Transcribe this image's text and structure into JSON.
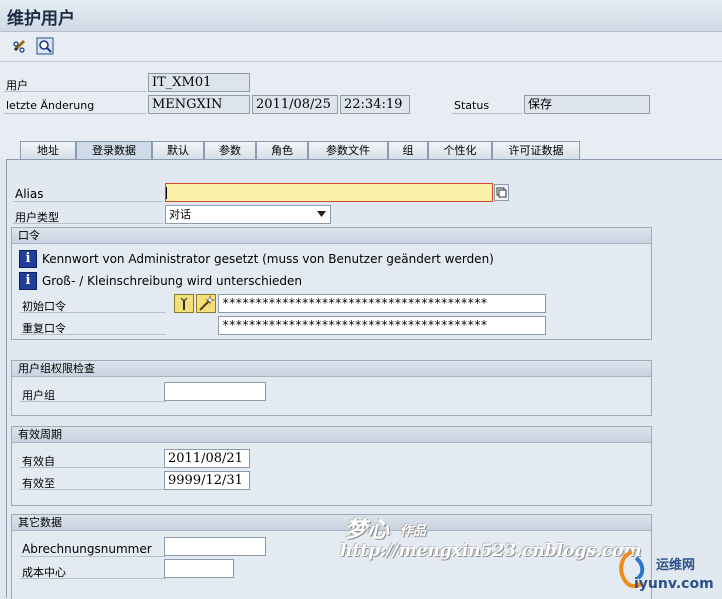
{
  "window": {
    "title": "维护用户"
  },
  "header": {
    "user_label": "用户",
    "user_value": "IT_XM01",
    "changed_label": "letzte Änderung",
    "changed_by": "MENGXIN",
    "changed_date": "2011/08/25",
    "changed_time": "22:34:19",
    "status_label": "Status",
    "status_value": "保存"
  },
  "tabs": [
    "地址",
    "登录数据",
    "默认",
    "参数",
    "角色",
    "参数文件",
    "组",
    "个性化",
    "许可证数据"
  ],
  "active_tab": "登录数据",
  "logon": {
    "alias_label": "Alias",
    "alias_value": "",
    "user_type_label": "用户类型",
    "user_type_value": "对话"
  },
  "password": {
    "section_title": "口令",
    "msg1": "Kennwort von Administrator gesetzt (muss von Benutzer geändert werden)",
    "msg2": "Groß- / Kleinschreibung wird unterschieden",
    "initial_label": "初始口令",
    "initial_value": "****************************************",
    "repeat_label": "重复口令",
    "repeat_value": "****************************************"
  },
  "usergroup": {
    "section_title": "用户组权限检查",
    "group_label": "用户组",
    "group_value": ""
  },
  "validity": {
    "section_title": "有效周期",
    "from_label": "有效自",
    "from_value": "2011/08/21",
    "to_label": "有效至",
    "to_value": "9999/12/31"
  },
  "other": {
    "section_title": "其它数据",
    "account_label": "Abrechnungsnummer",
    "account_value": "",
    "costcenter_label": "成本中心",
    "costcenter_value": ""
  },
  "watermark": {
    "line1": "梦心",
    "line1b": "作品",
    "line2": "http://mengxin523.cnblogs.com",
    "site_cn": "运维网",
    "site_url": "iyunv.com"
  },
  "icons": [
    "pencil-glasses-icon",
    "magnifier-icon",
    "possible-entries-icon",
    "dropdown-arrow-icon",
    "info-icon",
    "password-generator-icon",
    "magic-wand-icon"
  ]
}
